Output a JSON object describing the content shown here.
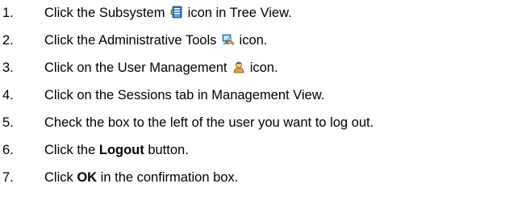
{
  "steps": [
    {
      "number": "1.",
      "before": "Click the Subsystem ",
      "after": " icon in Tree View.",
      "icon": "subsystem-icon"
    },
    {
      "number": "2.",
      "before": "Click the Administrative Tools ",
      "after": " icon.",
      "icon": "administrative-tools-icon"
    },
    {
      "number": "3.",
      "before": "Click on the User Management ",
      "after": " icon.",
      "icon": "user-management-icon"
    },
    {
      "number": "4.",
      "text": "Click on the Sessions tab in Management View."
    },
    {
      "number": "5.",
      "text": "Check the box to the left of the user you want to log out."
    },
    {
      "number": "6.",
      "before": "Click the ",
      "bold": "Logout",
      "after": " button."
    },
    {
      "number": "7.",
      "before": "Click ",
      "bold": "OK",
      "after": " in the confirmation box."
    }
  ],
  "colors": {
    "text": "#000000",
    "subsystem_icon": "#2f6fd6",
    "admin_tools_icon": "#3aa7d9",
    "user_icon": "#e6a33c"
  }
}
